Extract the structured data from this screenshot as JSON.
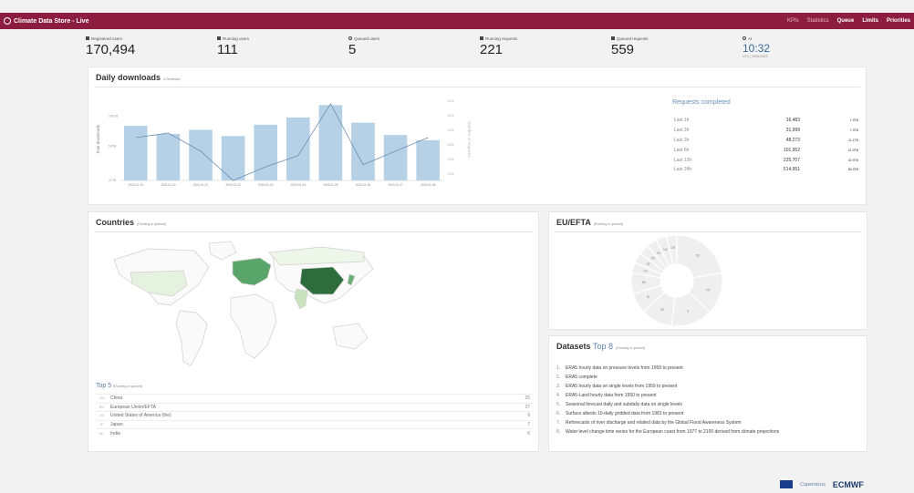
{
  "header": {
    "title": "Climate Data Store - Live",
    "nav": [
      {
        "label": "KPIs",
        "active": false
      },
      {
        "label": "Statistics",
        "active": false
      },
      {
        "label": "Queue",
        "active": true
      },
      {
        "label": "Limits",
        "active": true
      },
      {
        "label": "Priorities",
        "active": true
      }
    ]
  },
  "stats": {
    "registered": {
      "label": "Registered users",
      "value": "170,494"
    },
    "running_users": {
      "label": "Running users",
      "value": "111"
    },
    "queued_users": {
      "label": "Queued users",
      "value": "5"
    },
    "running_requests": {
      "label": "Running requests",
      "value": "221"
    },
    "queued_requests": {
      "label": "Queued requests",
      "value": "559"
    },
    "clock": {
      "label": "At",
      "value": "10:32",
      "sub": "UTC | 29/01/2023"
    }
  },
  "downloads": {
    "title": "Daily downloads",
    "subtitle": "in Terabytes",
    "chart_data": {
      "type": "bar",
      "categories": [
        "2023-01-19",
        "2023-01-20",
        "2023-01-21",
        "2023-01-22",
        "2023-01-23",
        "2023-01-24",
        "2023-01-25",
        "2023-01-26",
        "2023-01-27",
        "2023-01-28"
      ],
      "series": [
        {
          "values": [
            90,
            82,
            86,
            80,
            91,
            98,
            110,
            93,
            81,
            76
          ]
        },
        {
          "values": [
            570,
            590,
            510,
            380,
            440,
            490,
            720,
            450,
            510,
            570
          ]
        }
      ],
      "ylabel": "Total downloads",
      "y2label": "Number of requests",
      "y_ticks": [
        "37TB",
        "50TB",
        "100TB"
      ],
      "y2_ticks": [
        "250k",
        "300k",
        "350k",
        "400k",
        "450k",
        "500k"
      ],
      "ylim": [
        37,
        120
      ],
      "y2lim": [
        380,
        760
      ]
    }
  },
  "requests": {
    "title": "Requests completed",
    "rows": [
      {
        "period": "Last 1h",
        "count": "16,483",
        "size": "1.9TB"
      },
      {
        "period": "Last 2h",
        "count": "31,999",
        "size": "7.3TB"
      },
      {
        "period": "Last 3h",
        "count": "48,273",
        "size": "11.1TB"
      },
      {
        "period": "Last 6h",
        "count": "101,952",
        "size": "21.9TB"
      },
      {
        "period": "Last 12h",
        "count": "225,707",
        "size": "42.9TB"
      },
      {
        "period": "Last 24h",
        "count": "514,951",
        "size": "80.3TB"
      }
    ]
  },
  "countries": {
    "title": "Countries",
    "subtitle": "(Running or queued)",
    "top5_title": "Top 5",
    "top5_subtitle": "(Running or queued)",
    "top5": [
      {
        "code": "CN",
        "name": "China",
        "value": "25"
      },
      {
        "code": "EU",
        "name": "European Union/EFTA",
        "value": "27"
      },
      {
        "code": "US",
        "name": "United States of America (the)",
        "value": "9"
      },
      {
        "code": "JP",
        "name": "Japan",
        "value": "7"
      },
      {
        "code": "IN",
        "name": "India",
        "value": "6"
      }
    ]
  },
  "euefta": {
    "title": "EU/EFTA",
    "subtitle": "(Running or queued)",
    "slices": [
      {
        "label": "DE",
        "value": 6
      },
      {
        "label": "FR",
        "value": 4
      },
      {
        "label": "IT",
        "value": 4
      },
      {
        "label": "ES",
        "value": 3
      },
      {
        "label": "NL",
        "value": 2
      },
      {
        "label": "BE",
        "value": 2
      },
      {
        "label": "CH",
        "value": 1
      },
      {
        "label": "AT",
        "value": 1
      },
      {
        "label": "DK",
        "value": 1
      },
      {
        "label": "SE",
        "value": 1
      },
      {
        "label": "NO",
        "value": 1
      },
      {
        "label": "GR",
        "value": 1
      }
    ]
  },
  "datasets": {
    "title": "Datasets",
    "accent": "Top 8",
    "subtitle": "(Running or queued)",
    "items": [
      "ERA5 hourly data on pressure levels from 1959 to present",
      "ERA5 complete",
      "ERA5 hourly data on single levels from 1959 to present",
      "ERA5-Land hourly data from 1950 to present",
      "Seasonal forecast daily and subdaily data on single levels",
      "Surface albedo 10-daily gridded data from 1981 to present",
      "Reforecasts of river discharge and related data by the Global Flood Awareness System",
      "Water level change time series for the European coast from 1977 to 2100 derived from climate projections"
    ]
  },
  "footer": {
    "copernicus": "Copernicus",
    "ecmwf": "ECMWF"
  },
  "colors": {
    "brand": "#8c1d40",
    "bar": "#b6d0e6",
    "line": "#6a8fb5",
    "accent": "#5b7fa8"
  }
}
